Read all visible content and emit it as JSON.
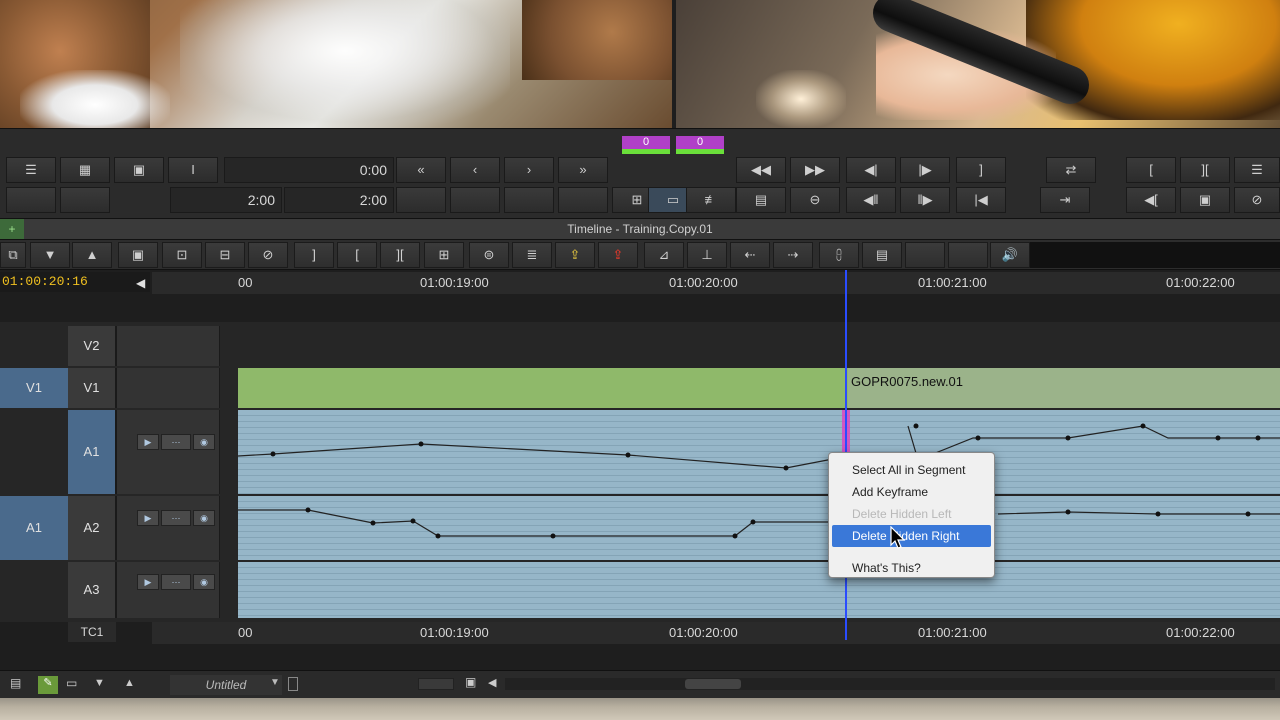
{
  "mark_in_out": {
    "in_label": "0",
    "out_label": "0"
  },
  "monitor_controls": {
    "top_time": "0:00",
    "duration_left": "2:00",
    "duration_right": "2:00"
  },
  "timeline": {
    "title": "Timeline - Training.Copy.01",
    "position": "01:00:20:16"
  },
  "ruler": {
    "ticks": [
      "00",
      "01:00:19:00",
      "01:00:20:00",
      "01:00:21:00",
      "01:00:22:00"
    ]
  },
  "tracks": {
    "v2": "V2",
    "v1_source": "V1",
    "v1": "V1",
    "a1": "A1",
    "a1_source": "A1",
    "a2": "A2",
    "a3": "A3",
    "tc1": "TC1",
    "clip_name": "GOPR0075.new.01"
  },
  "context_menu": {
    "items": [
      "Select All in Segment",
      "Add Keyframe",
      "Delete Hidden Left",
      "Delete Hidden Right",
      "What's This?"
    ]
  },
  "bottom_bar": {
    "bin_name": "Untitled"
  },
  "colors": {
    "video_clip": "#8fb96a",
    "audio_clip": "#96b6c8",
    "mark_color": "#b040c8",
    "playhead": "#2a4cff",
    "menu_highlight": "#3a78d8"
  }
}
